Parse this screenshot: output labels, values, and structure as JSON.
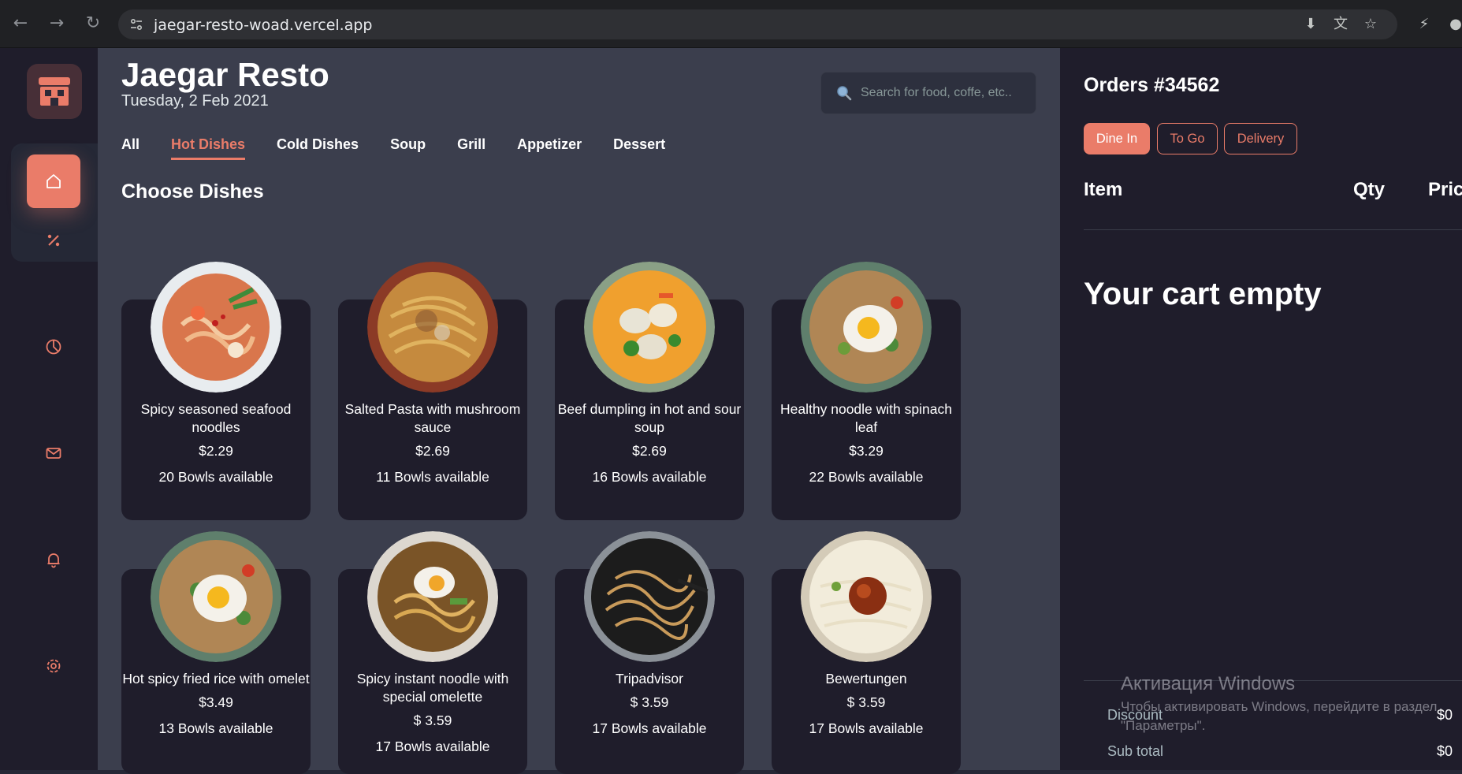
{
  "browser": {
    "url": "jaegar-resto-woad.vercel.app"
  },
  "header": {
    "title": "Jaegar Resto",
    "date": "Tuesday, 2 Feb 2021",
    "search_placeholder": "Search for food, coffe, etc.."
  },
  "tabs": [
    "All",
    "Hot Dishes",
    "Cold Dishes",
    "Soup",
    "Grill",
    "Appetizer",
    "Dessert"
  ],
  "active_tab": "Hot Dishes",
  "section_title": "Choose Dishes",
  "dishes": [
    {
      "name": "Spicy seasoned seafood noodles",
      "price": "$2.29",
      "availability": "20 Bowls available"
    },
    {
      "name": "Salted Pasta with mushroom sauce",
      "price": "$2.69",
      "availability": "11 Bowls available"
    },
    {
      "name": "Beef dumpling in hot and sour soup",
      "price": "$2.69",
      "availability": "16 Bowls available"
    },
    {
      "name": "Healthy noodle with spinach leaf",
      "price": "$3.29",
      "availability": "22 Bowls available"
    },
    {
      "name": "Hot spicy fried rice with omelet",
      "price": "$3.49",
      "availability": "13 Bowls available"
    },
    {
      "name": "Spicy instant noodle with special omelette",
      "price": "$ 3.59",
      "availability": "17 Bowls available"
    },
    {
      "name": "Tripadvisor",
      "price": "$ 3.59",
      "availability": "17 Bowls available"
    },
    {
      "name": "Bewertungen",
      "price": "$ 3.59",
      "availability": "17 Bowls available"
    }
  ],
  "orders": {
    "title": "Orders #34562",
    "order_types": [
      "Dine In",
      "To Go",
      "Delivery"
    ],
    "active_order_type": "Dine In",
    "columns": {
      "item": "Item",
      "qty": "Qty",
      "price": "Pric"
    },
    "cart_empty_text": "Your cart empty",
    "discount_label": "Discount",
    "discount_value": "$0",
    "subtotal_label": "Sub total",
    "subtotal_value": "$0"
  },
  "watermark": {
    "title": "Активация Windows",
    "text": "Чтобы активировать Windows, перейдите в раздел \"Параметры\"."
  },
  "colors": {
    "accent": "#ea7c69",
    "sidebar_bg": "#1f1d2b",
    "main_bg": "#3b3e4d",
    "card_bg": "#1f1d2b"
  },
  "icons": {
    "sidebar": [
      "restaurant-logo-icon",
      "home-icon",
      "discount-icon",
      "dashboard-pie-icon",
      "message-icon",
      "notification-bell-icon",
      "settings-gear-icon"
    ]
  }
}
